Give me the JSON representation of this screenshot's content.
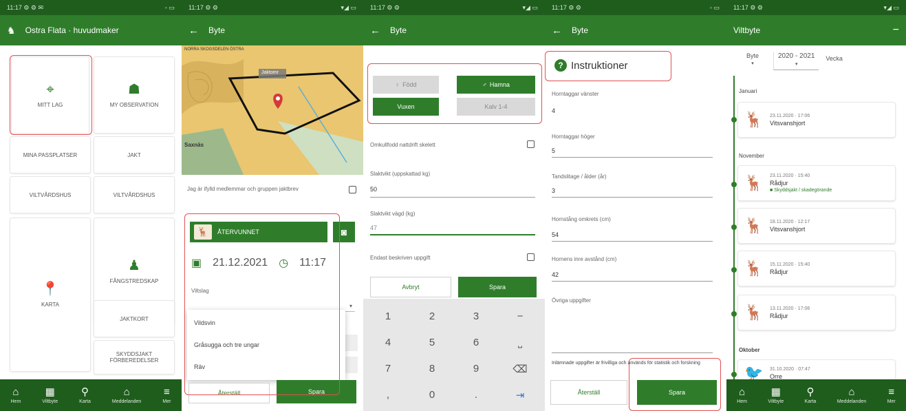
{
  "colors": {
    "primary": "#2f7d2b",
    "status_bar": "#1f5d1d",
    "highlight": "#e05050"
  },
  "screen1": {
    "status": {
      "time": "11:17 ⚙ ⚙ ✉",
      "right": "◦ ▭"
    },
    "appbar": {
      "title": "Ostra Flata · huvudmaker",
      "icon": "moose-icon"
    },
    "tiles": {
      "mitt_lag": "MITT LAG",
      "my_observation": "MY OBSERVATION",
      "mina_pass": "MINA PASSPLATSER",
      "jakt": "JAKT",
      "viltvard_1": "VILTVÅRDSHUS",
      "viltvard_2": "VILTVÅRDSHUS",
      "fangstredskap": "FÅNGSTREDSKAP",
      "karta": "KARTA",
      "jaktkort": "JAKTKORT",
      "skyddsjakt": "SKYDDSJAKT FÖRBEREDELSER"
    }
  },
  "screen2": {
    "status": {
      "time": "11:17 ⚙ ⚙",
      "right": "▾◢ ▭"
    },
    "appbar": {
      "title": "Byte"
    },
    "map_label": "Jaktomr",
    "map_caption": "NORRA SKOGSDELEN ÖSTRA",
    "map_area": "Saxnäs",
    "report_text": "Jag är ifylld medlemmar och gruppen jaktbrev",
    "species": "ÅTERVUNNET",
    "date": "21.12.2021",
    "time": "11:17",
    "field_label": "Viltslag",
    "dropdown": [
      "Vildsvin",
      "Gråsugga och tre ungar",
      "Räv"
    ],
    "cancel": "Återställ",
    "save": "Spara"
  },
  "screen3": {
    "status": {
      "time": "11:17 ⚙ ⚙",
      "right": "▾◢ ▭"
    },
    "appbar": {
      "title": "Byte"
    },
    "choices": {
      "fodd": "Född",
      "hamna": "Hamna",
      "vuxen": "Vuxen",
      "kalv": "Kalv 1-4"
    },
    "q1": "Omkullfodd nattdrift skelett",
    "f1_label": "Slaktvikt (uppskattad kg)",
    "f1_value": "50",
    "f2_label": "Slaktvikt vägd (kg)",
    "f2_value": "47",
    "q2": "Endast beskriven uppgift",
    "cancel": "Avbryt",
    "save": "Spara",
    "keys": [
      "1",
      "2",
      "3",
      "−",
      "4",
      "5",
      "6",
      "⎵",
      "7",
      "8",
      "9",
      "⌫",
      ",",
      "0",
      ".",
      "⇥"
    ]
  },
  "screen4": {
    "status": {
      "time": "11:17 ⚙ ⚙",
      "right": "◦ ▭"
    },
    "appbar": {
      "title": "Byte"
    },
    "instr_title": "Instruktioner",
    "fields": [
      {
        "label": "Horntaggar vänster",
        "value": "4"
      },
      {
        "label": "Horntaggar höger",
        "value": "5"
      },
      {
        "label": "Tandslitage / ålder (år)",
        "value": "3"
      },
      {
        "label": "Hornstång omkrets (cm)",
        "value": "54"
      },
      {
        "label": "Hornens inre avstånd (cm)",
        "value": "42"
      },
      {
        "label": "Övriga uppgifter",
        "value": ""
      }
    ],
    "footnote": "Inlämnade uppgifter är frivilliga och används för statistik och forskning",
    "cancel": "Återställ",
    "save": "Spara"
  },
  "screen5": {
    "status": {
      "time": "11:17 ⚙ ⚙",
      "right": "▾◢ ▭"
    },
    "appbar": {
      "title": "Viltbyte",
      "action": "−"
    },
    "filters": {
      "type": "Byte",
      "season": "2020 - 2021",
      "period": "Vecka"
    },
    "months": [
      "Januari",
      "November",
      "Oktober"
    ],
    "entries": [
      {
        "date": "23.11.2020 · 17:06",
        "species": "Vitsvanshjort",
        "tag": ""
      },
      {
        "date": "23.11.2020 · 15:40",
        "species": "Rådjur",
        "tag": "■ Skyddsjakt / skadegörande"
      },
      {
        "date": "18.11.2020 · 12:17",
        "species": "Vitsvanshjort",
        "tag": ""
      },
      {
        "date": "15.11.2020 · 15:40",
        "species": "Rådjur",
        "tag": ""
      },
      {
        "date": "13.11.2020 · 17:06",
        "species": "Rådjur",
        "tag": ""
      },
      {
        "date": "31.10.2020 · 07:47",
        "species": "Orre",
        "tag": ""
      }
    ]
  },
  "nav": {
    "screen1": [
      "Hem",
      "Viltbyte",
      "Karta",
      "Meddelanden",
      "Mer"
    ],
    "screen5": [
      "Hem",
      "Viltbyte",
      "Karta",
      "Meddelanden",
      "Mer"
    ]
  }
}
